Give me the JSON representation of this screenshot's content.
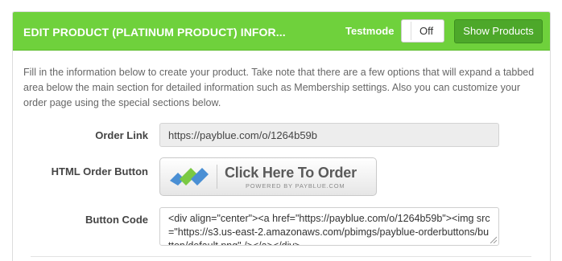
{
  "header": {
    "title": "EDIT PRODUCT (PLATINUM PRODUCT) INFOR...",
    "testmode_label": "Testmode",
    "testmode_state": "Off",
    "show_products_label": "Show Products"
  },
  "intro": "Fill in the information below to create your product. Take note that there are a few options that will expand a tabbed area below the main section for detailed information such as Membership settings. Also you can customize your order page using the special sections below.",
  "fields": {
    "order_link": {
      "label": "Order Link",
      "value": "https://payblue.com/o/1264b59b"
    },
    "html_order_button": {
      "label": "HTML Order Button",
      "button_text": "Click Here To Order",
      "powered_by": "POWERED BY PAYBLUE.COM"
    },
    "button_code": {
      "label": "Button Code",
      "value": "<div align=\"center\"><a href=\"https://payblue.com/o/1264b59b\"><img src=\"https://s3.us-east-2.amazonaws.com/pbimgs/payblue-orderbuttons/button/default.png\" /></a></div>"
    }
  },
  "colors": {
    "header_green": "#6fd13c",
    "button_green": "#4da82a",
    "logo_blue": "#4a8fd4",
    "logo_green": "#7ac943"
  }
}
